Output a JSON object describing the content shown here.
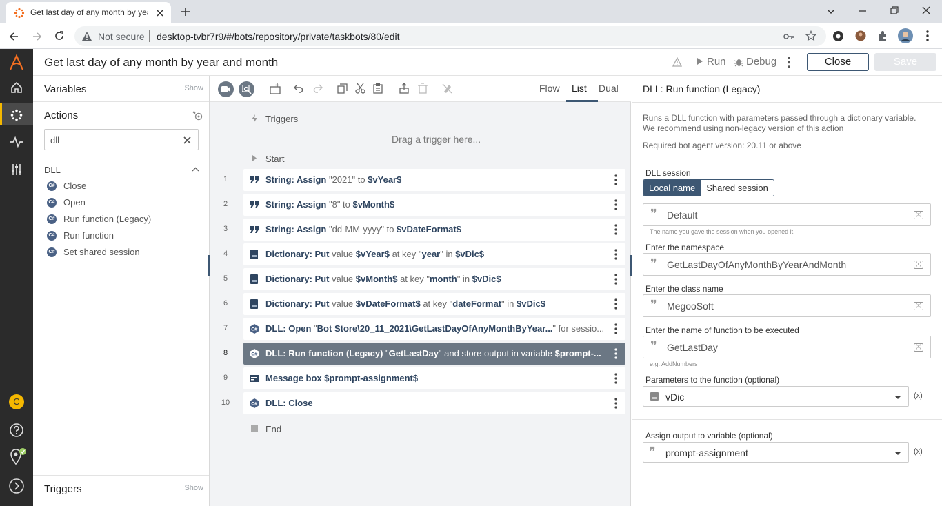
{
  "browser": {
    "tab_title": "Get last day of any month by year and month",
    "not_secure": "Not secure",
    "url": "desktop-tvbr7r9/#/bots/repository/private/taskbots/80/edit"
  },
  "nav": {
    "user_initial": "C"
  },
  "header": {
    "title": "Get last day of any month by year and month",
    "run_label": "Run",
    "debug_label": "Debug",
    "close_label": "Close",
    "save_label": "Save"
  },
  "left": {
    "variables_title": "Variables",
    "variables_show": "Show",
    "actions_title": "Actions",
    "search_value": "dll",
    "group_title": "DLL",
    "items": [
      {
        "label": "Close"
      },
      {
        "label": "Open"
      },
      {
        "label": "Run function (Legacy)"
      },
      {
        "label": "Run function"
      },
      {
        "label": "Set shared session"
      }
    ],
    "triggers_title": "Triggers",
    "triggers_show": "Show"
  },
  "center": {
    "views": {
      "flow": "Flow",
      "list": "List",
      "dual": "Dual"
    },
    "triggers_label": "Triggers",
    "drag_trigger": "Drag a trigger here...",
    "start_label": "Start",
    "end_label": "End",
    "steps": [
      {
        "num": "1",
        "kind": "quote",
        "parts": [
          {
            "b": "String: Assign"
          },
          {
            "t": " \"2021\" to "
          },
          {
            "b": "$vYear$"
          }
        ]
      },
      {
        "num": "2",
        "kind": "quote",
        "parts": [
          {
            "b": "String: Assign"
          },
          {
            "t": " \"8\" to "
          },
          {
            "b": "$vMonth$"
          }
        ]
      },
      {
        "num": "3",
        "kind": "quote",
        "parts": [
          {
            "b": "String: Assign"
          },
          {
            "t": " \"dd-MM-yyyy\" to "
          },
          {
            "b": "$vDateFormat$"
          }
        ]
      },
      {
        "num": "4",
        "kind": "dict",
        "parts": [
          {
            "b": "Dictionary: Put"
          },
          {
            "t": " value "
          },
          {
            "b": "$vYear$"
          },
          {
            "t": " at key \""
          },
          {
            "b": "year"
          },
          {
            "t": "\" in "
          },
          {
            "b": "$vDic$"
          }
        ]
      },
      {
        "num": "5",
        "kind": "dict",
        "parts": [
          {
            "b": "Dictionary: Put"
          },
          {
            "t": " value "
          },
          {
            "b": "$vMonth$"
          },
          {
            "t": " at key \""
          },
          {
            "b": "month"
          },
          {
            "t": "\" in "
          },
          {
            "b": "$vDic$"
          }
        ]
      },
      {
        "num": "6",
        "kind": "dict",
        "parts": [
          {
            "b": "Dictionary: Put"
          },
          {
            "t": " value "
          },
          {
            "b": "$vDateFormat$"
          },
          {
            "t": " at key \""
          },
          {
            "b": "dateFormat"
          },
          {
            "t": "\" in "
          },
          {
            "b": "$vDic$"
          }
        ]
      },
      {
        "num": "7",
        "kind": "dll",
        "parts": [
          {
            "b": "DLL: Open"
          },
          {
            "t": " \""
          },
          {
            "b": "Bot Store\\20_11_2021\\GetLastDayOfAnyMonthByYear..."
          },
          {
            "t": "\" for sessio..."
          }
        ]
      },
      {
        "num": "8",
        "kind": "dll",
        "selected": true,
        "parts": [
          {
            "b": "DLL: Run function (Legacy)"
          },
          {
            "t": " \""
          },
          {
            "b": "GetLastDay"
          },
          {
            "t": "\" and store output in variable "
          },
          {
            "b": "$prompt-..."
          }
        ]
      },
      {
        "num": "9",
        "kind": "msg",
        "parts": [
          {
            "b": "Message box"
          },
          {
            "t": " "
          },
          {
            "b": "$prompt-assignment$"
          }
        ]
      },
      {
        "num": "10",
        "kind": "dll",
        "parts": [
          {
            "b": "DLL: Close"
          }
        ]
      }
    ]
  },
  "right": {
    "title": "DLL: Run function (Legacy)",
    "desc1": "Runs a DLL function with parameters passed through a dictionary variable.",
    "desc2": "We recommend using non-legacy version of this action",
    "required": "Required bot agent version: 20.11 or above",
    "session_label": "DLL session",
    "seg_local": "Local name",
    "seg_shared": "Shared session",
    "session_value": "Default",
    "session_hint": "The name you gave the session when you opened it.",
    "namespace_label": "Enter the namespace",
    "namespace_value": "GetLastDayOfAnyMonthByYearAndMonth",
    "class_label": "Enter the class name",
    "class_value": "MegooSoft",
    "func_label": "Enter the name of function to be executed",
    "func_value": "GetLastDay",
    "func_hint": "e.g. AddNumbers",
    "params_label": "Parameters to the function (optional)",
    "params_value": "vDic",
    "output_label": "Assign output to variable (optional)",
    "output_value": "prompt-assignment",
    "var_badge": "(x)",
    "fx_badge": "(x)"
  },
  "colors": {
    "accent": "#3d5773",
    "selected_row": "#6b7784",
    "nav_bg": "#2b2b2b",
    "active_marker": "#f5b800"
  }
}
